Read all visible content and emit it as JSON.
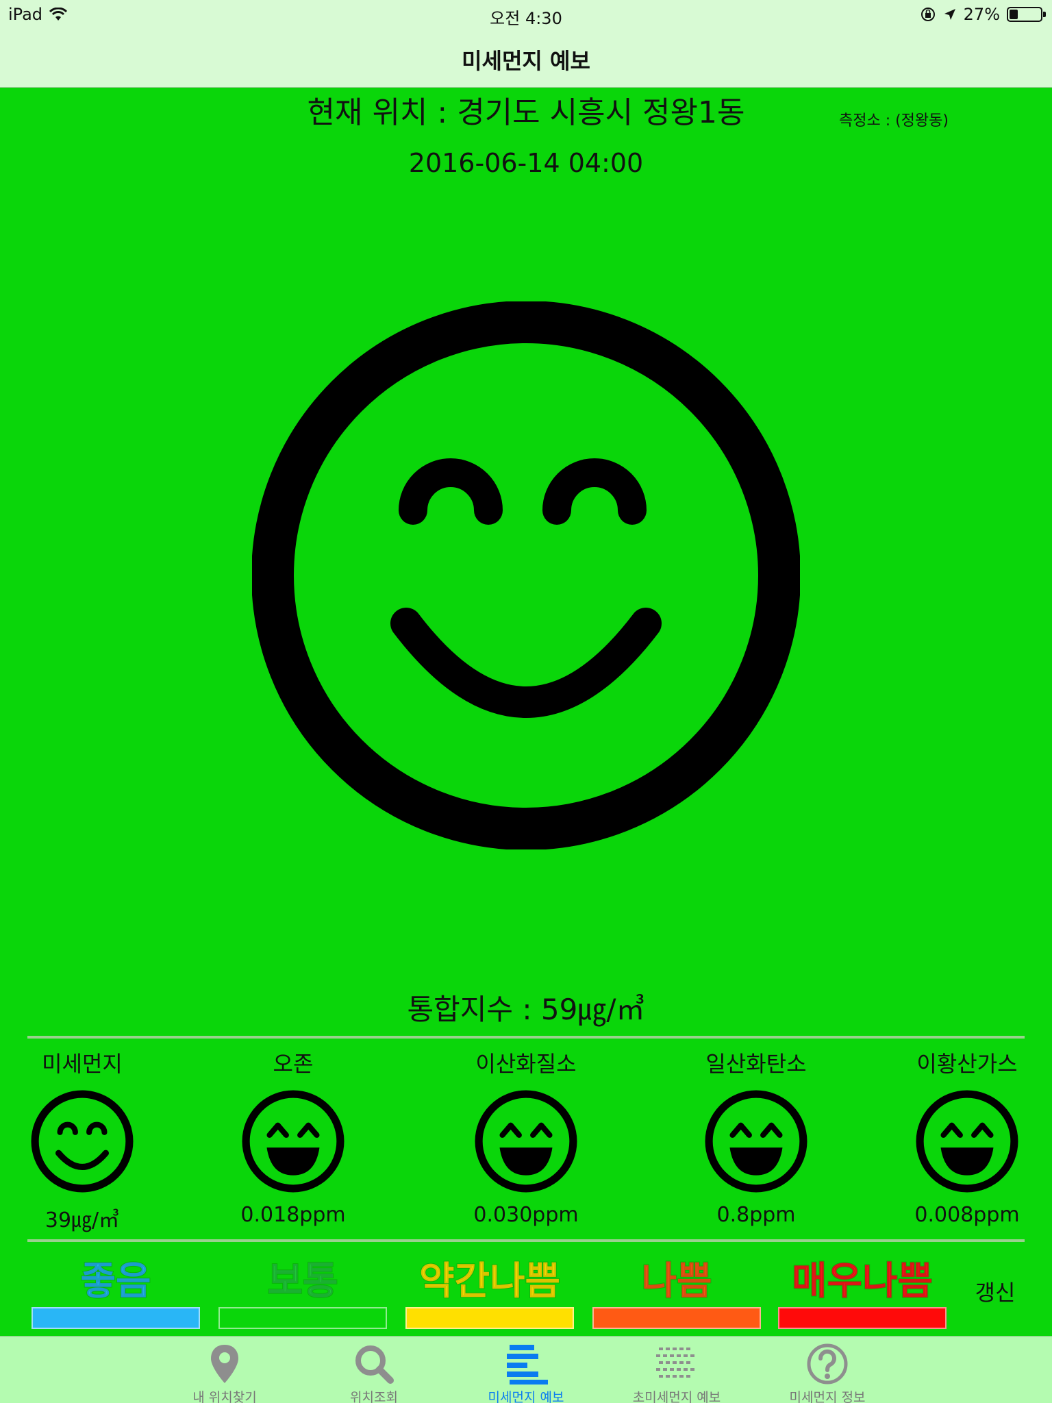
{
  "status_bar": {
    "device": "iPad",
    "time": "오전 4:30",
    "battery": "27%",
    "battery_level": 0.27
  },
  "nav": {
    "title": "미세먼지 예보"
  },
  "location": {
    "text": "현재 위치 : 경기도 시흥시 정왕1동",
    "station": "측정소 : (정왕동)"
  },
  "datetime": "2016-06-14 04:00",
  "main_face": {
    "icon": "smile-face-icon",
    "color": "#000000"
  },
  "combined_index": "통합지수 : 59㎍/㎥",
  "pollutants": [
    {
      "label": "미세먼지",
      "value": "39㎍/㎥",
      "icon": "smile-face-icon"
    },
    {
      "label": "오존",
      "value": "0.018ppm",
      "icon": "grin-face-icon"
    },
    {
      "label": "이산화질소",
      "value": "0.030ppm",
      "icon": "grin-face-icon"
    },
    {
      "label": "일산화탄소",
      "value": "0.8ppm",
      "icon": "grin-face-icon"
    },
    {
      "label": "이황산가스",
      "value": "0.008ppm",
      "icon": "grin-face-icon"
    }
  ],
  "legend": [
    {
      "label": "좋음",
      "text_color": "#22b8f0",
      "bar_color": "#29b6f6"
    },
    {
      "label": "보통",
      "text_color": "#1fcf3a",
      "bar_color": "#0ad60a"
    },
    {
      "label": "약간나쁨",
      "text_color": "#ffe600",
      "bar_color": "#ffe000"
    },
    {
      "label": "나쁨",
      "text_color": "#ff5a14",
      "bar_color": "#ff5a14"
    },
    {
      "label": "매우나쁨",
      "text_color": "#ff1a1a",
      "bar_color": "#ff0a0a"
    }
  ],
  "refresh_label": "갱신",
  "tabs": [
    {
      "label": "내 위치찾기",
      "icon": "location-pin-icon",
      "active": false
    },
    {
      "label": "위치조회",
      "icon": "search-icon",
      "active": false
    },
    {
      "label": "미세먼지 예보",
      "icon": "bars-icon",
      "active": true
    },
    {
      "label": "초미세먼지 예보",
      "icon": "dots-grid-icon",
      "active": false
    },
    {
      "label": "미세먼지 정보",
      "icon": "question-circle-icon",
      "active": false
    }
  ],
  "colors": {
    "background": "#0ad60a",
    "bar_bg": "#d8fad4",
    "tab_bg": "#b4fbb0",
    "active_tab": "#0a7cf0"
  }
}
